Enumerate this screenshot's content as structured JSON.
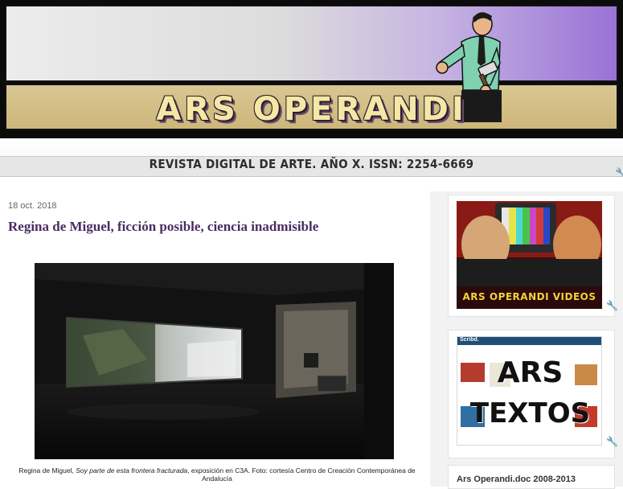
{
  "header": {
    "title": "ARS OPERANDI",
    "subtitle": "REVISTA DIGITAL DE ARTE.  AÑO X.  ISSN: 2254-6669"
  },
  "post": {
    "date": "18 oct. 2018",
    "title": "Regina de Miguel, ficción posible, ciencia inadmisible",
    "caption_prefix": "Regina de Miguel, ",
    "caption_italic": "Soy parte de esta frontera fracturada",
    "caption_suffix": ", exposición en C3A. Foto: cortesía Centro de Creación Contemporánea de Andalucía"
  },
  "sidebar": {
    "videos_banner_text": "ARS OPERANDI VIDEOS",
    "textos_line1": "ARS",
    "textos_line2": "TEXTOS",
    "scribd_label": "Scribd.",
    "doc_heading": "Ars Operandi.doc 2008-2013"
  },
  "icons": [
    "edit-wrench-icon"
  ],
  "colors": {
    "post_title": "#4a2c63",
    "banner_title": "#f6e7a6",
    "videos_text": "#f2d23a"
  }
}
